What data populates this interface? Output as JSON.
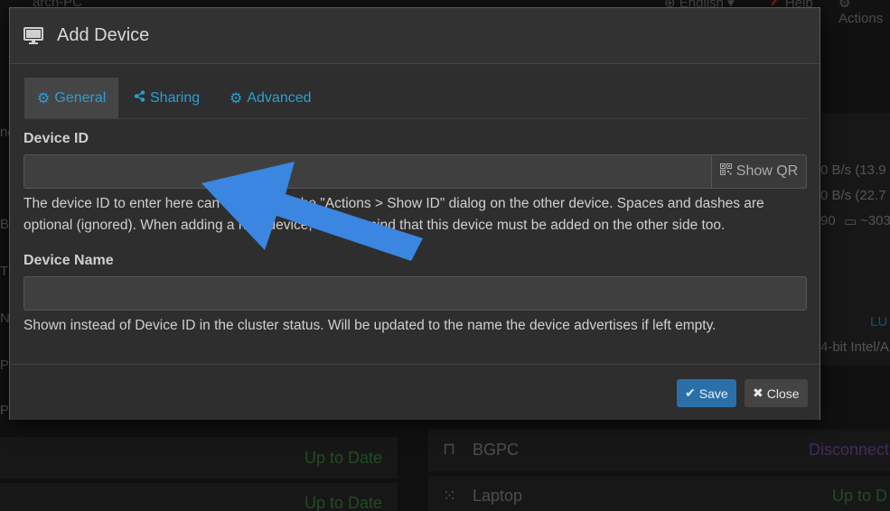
{
  "background": {
    "title": "arch-PC",
    "nav": {
      "language": "English",
      "help": "Help",
      "actions": "Actions"
    },
    "left_fragments": [
      "ne",
      "B",
      "T",
      "N",
      "P",
      "P"
    ],
    "right_fragments": {
      "rate_1": "0 B/s (13.9",
      "rate_2": "0 B/s (22.7",
      "count": "90",
      "size": "~303",
      "link": "LU",
      "arch": "4-bit Intel/A"
    },
    "folders": [
      {
        "status": "Up to Date"
      },
      {
        "status": "Up to Date"
      }
    ],
    "devices": [
      {
        "name": "BGPC",
        "status": "Disconnect",
        "status_color": "#7a4ea8"
      },
      {
        "name": "Laptop",
        "status": "Up to D",
        "status_color": "#3d8a3d"
      }
    ]
  },
  "modal": {
    "title": "Add Device",
    "title_icon": "monitor-icon",
    "tabs": [
      {
        "label": "General",
        "icon": "gear-icon",
        "active": true
      },
      {
        "label": "Sharing",
        "icon": "share-icon",
        "active": false
      },
      {
        "label": "Advanced",
        "icon": "gears-icon",
        "active": false
      }
    ],
    "device_id": {
      "label": "Device ID",
      "value": "",
      "show_qr_label": "Show QR",
      "help": "The device ID to enter here can be found in the \"Actions > Show ID\" dialog on the other device. Spaces and dashes are optional (ignored). When adding a new device, keep in mind that this device must be added on the other side too."
    },
    "device_name": {
      "label": "Device Name",
      "value": "",
      "help": "Shown instead of Device ID in the cluster status. Will be updated to the name the device advertises if left empty."
    },
    "buttons": {
      "save": "Save",
      "close": "Close"
    }
  },
  "colors": {
    "accent": "#2a9fd6",
    "primary_button": "#2a6fa8",
    "annotation_arrow": "#3a86e0"
  }
}
